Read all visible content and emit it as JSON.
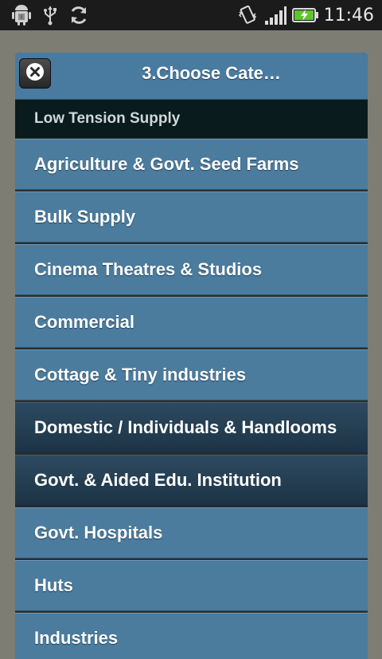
{
  "status_bar": {
    "time": "11:46",
    "icons": [
      "android-debug-icon",
      "usb-icon",
      "sync-icon",
      "vibrate-icon",
      "signal-icon",
      "battery-charging-icon"
    ]
  },
  "dialog": {
    "title": "3.Choose Cate…",
    "close_icon": "close-icon",
    "section_header": "Low Tension Supply",
    "items": [
      {
        "label": "Agriculture & Govt. Seed Farms"
      },
      {
        "label": "Bulk Supply"
      },
      {
        "label": "Cinema Theatres & Studios"
      },
      {
        "label": "Commercial"
      },
      {
        "label": "Cottage & Tiny industries"
      },
      {
        "label": "Domestic / Individuals & Handlooms"
      },
      {
        "label": "Govt. & Aided Edu. Institution"
      },
      {
        "label": "Govt. Hospitals"
      },
      {
        "label": "Huts"
      },
      {
        "label": "Industries"
      }
    ]
  },
  "colors": {
    "item_bg": "#4b7b9d",
    "item_selected_bg": "#243e52",
    "header_bg": "#497aa0",
    "section_bg": "#091b1d"
  }
}
